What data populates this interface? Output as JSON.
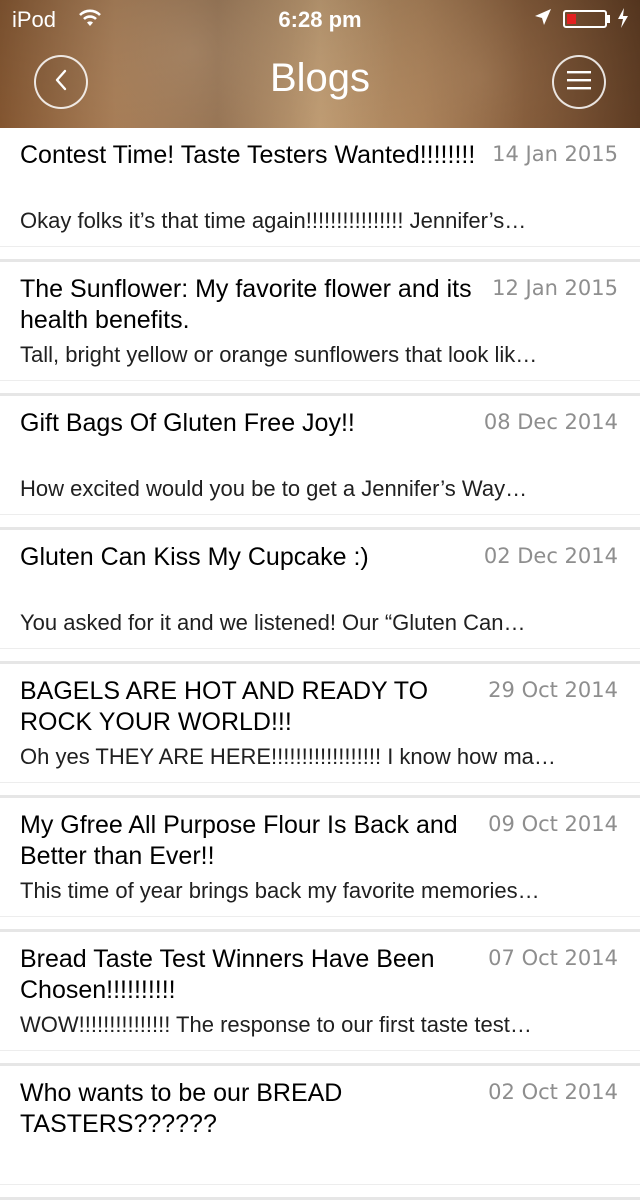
{
  "status_bar": {
    "carrier": "iPod",
    "time": "6:28 pm"
  },
  "nav": {
    "title": "Blogs"
  },
  "posts": [
    {
      "title": "Contest Time!  Taste Testers Wanted!!!!!!!!",
      "date": "14 Jan 2015",
      "excerpt": "Okay folks it’s that time again!!!!!!!!!!!!!!!! Jennifer’s…"
    },
    {
      "title": "The Sunflower: My favorite flower and its health benefits.",
      "date": "12 Jan 2015",
      "excerpt": "Tall, bright yellow or orange sunflowers that look lik…"
    },
    {
      "title": "Gift Bags Of Gluten Free Joy!!",
      "date": "08 Dec 2014",
      "excerpt": "How excited would you be to get a Jennifer’s Way…"
    },
    {
      "title": "Gluten Can Kiss My Cupcake :)",
      "date": "02 Dec 2014",
      "excerpt": "You asked for it and we listened! Our “Gluten Can…"
    },
    {
      "title": "BAGELS ARE HOT AND READY TO ROCK YOUR WORLD!!!",
      "date": "29 Oct 2014",
      "excerpt": "Oh yes THEY ARE HERE!!!!!!!!!!!!!!!!!!  I know how ma…"
    },
    {
      "title": "My Gfree All Purpose Flour Is Back and Better than Ever!!",
      "date": "09 Oct 2014",
      "excerpt": "This time of year brings back my favorite memories…"
    },
    {
      "title": "Bread Taste Test Winners Have Been Chosen!!!!!!!!!!",
      "date": "07 Oct 2014",
      "excerpt": "WOW!!!!!!!!!!!!!!!  The response to our first taste test…"
    },
    {
      "title": "Who wants to be our BREAD TASTERS??????",
      "date": "02 Oct 2014",
      "excerpt": ""
    }
  ]
}
